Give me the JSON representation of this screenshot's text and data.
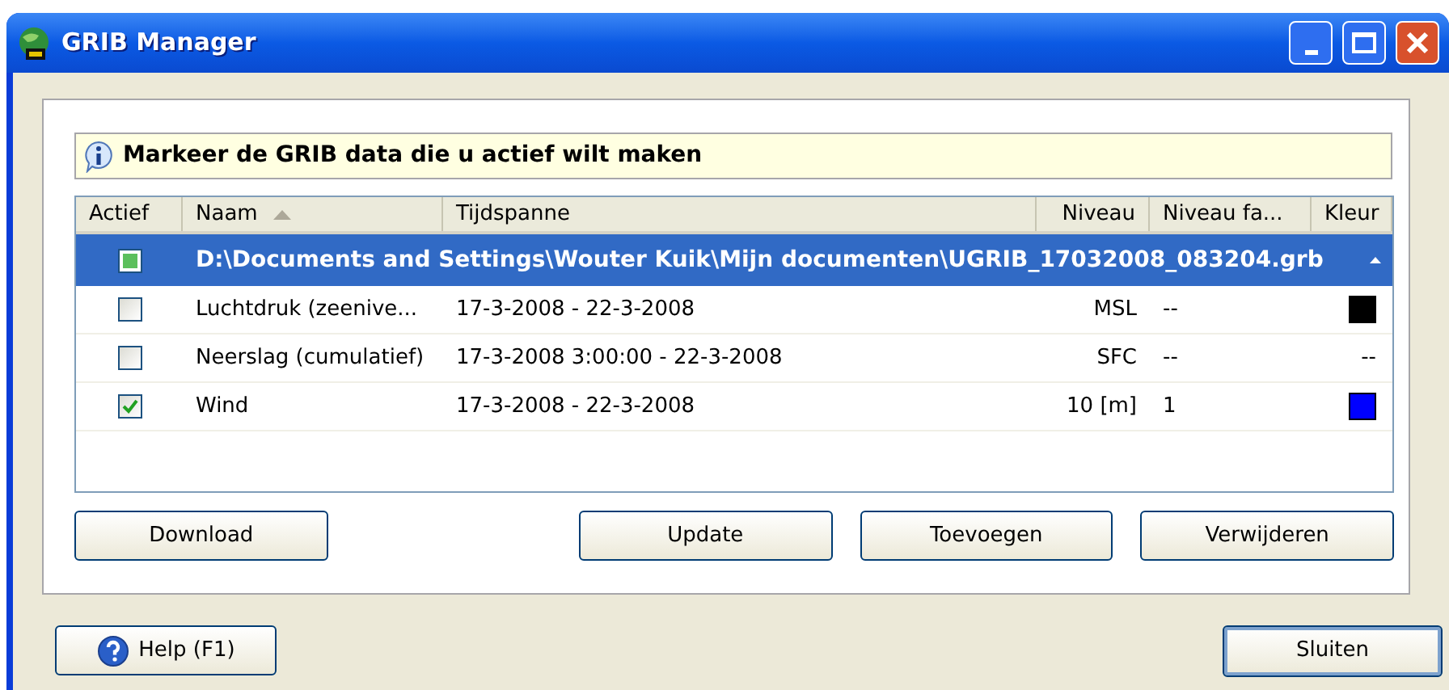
{
  "window": {
    "title": "GRIB Manager"
  },
  "info": "Markeer de GRIB data die u actief wilt maken",
  "table": {
    "columns": [
      {
        "label": "Actief",
        "sorted": false
      },
      {
        "label": "Naam",
        "sorted": true
      },
      {
        "label": "Tijdspanne",
        "sorted": false
      },
      {
        "label": "Niveau",
        "sorted": false
      },
      {
        "label": "Niveau fa...",
        "sorted": false
      },
      {
        "label": "Kleur",
        "sorted": false
      }
    ],
    "group": {
      "title": "D:\\Documents and Settings\\Wouter Kuik\\Mijn documenten\\UGRIB_17032008_083204.grb",
      "mixed": true,
      "expanded": true,
      "selected": true
    },
    "rows": [
      {
        "checked": false,
        "naam": "Luchtdruk (zeenive...",
        "tijdspanne": "17-3-2008 - 22-3-2008",
        "niveau": "MSL",
        "niveau_fa": "--",
        "color": "#000000"
      },
      {
        "checked": false,
        "naam": "Neerslag (cumulatief)",
        "tijdspanne": "17-3-2008 3:00:00 - 22-3-2008",
        "niveau": "SFC",
        "niveau_fa": "--",
        "kleur": "--"
      },
      {
        "checked": true,
        "naam": "Wind",
        "tijdspanne": "17-3-2008 - 22-3-2008",
        "niveau": "10 [m]",
        "niveau_fa": "1",
        "color": "#0000ff"
      }
    ]
  },
  "panel_buttons": [
    "Download",
    "Update",
    "Toevoegen",
    "Verwijderen"
  ],
  "help_button": "Help (F1)",
  "close_button": "Sluiten"
}
